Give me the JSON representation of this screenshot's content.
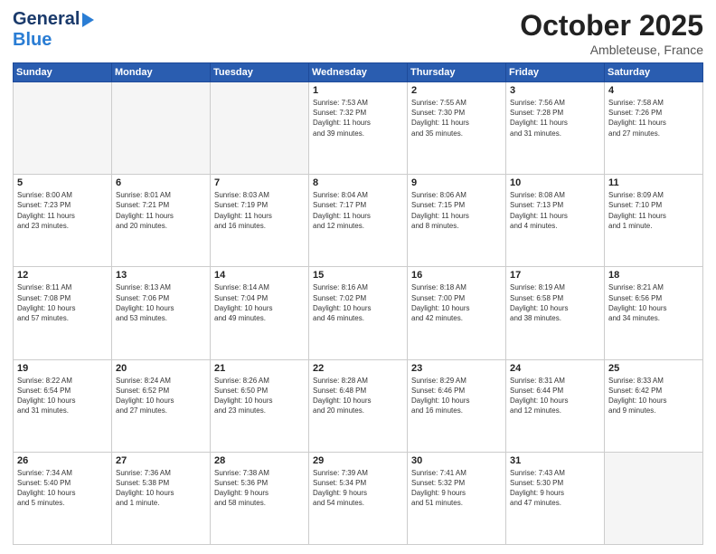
{
  "header": {
    "logo_line1": "General",
    "logo_line2": "Blue",
    "month": "October 2025",
    "location": "Ambleteuse, France"
  },
  "days_of_week": [
    "Sunday",
    "Monday",
    "Tuesday",
    "Wednesday",
    "Thursday",
    "Friday",
    "Saturday"
  ],
  "weeks": [
    [
      {
        "day": "",
        "empty": true,
        "lines": []
      },
      {
        "day": "",
        "empty": true,
        "lines": []
      },
      {
        "day": "",
        "empty": true,
        "lines": []
      },
      {
        "day": "1",
        "empty": false,
        "lines": [
          "Sunrise: 7:53 AM",
          "Sunset: 7:32 PM",
          "Daylight: 11 hours",
          "and 39 minutes."
        ]
      },
      {
        "day": "2",
        "empty": false,
        "lines": [
          "Sunrise: 7:55 AM",
          "Sunset: 7:30 PM",
          "Daylight: 11 hours",
          "and 35 minutes."
        ]
      },
      {
        "day": "3",
        "empty": false,
        "lines": [
          "Sunrise: 7:56 AM",
          "Sunset: 7:28 PM",
          "Daylight: 11 hours",
          "and 31 minutes."
        ]
      },
      {
        "day": "4",
        "empty": false,
        "lines": [
          "Sunrise: 7:58 AM",
          "Sunset: 7:26 PM",
          "Daylight: 11 hours",
          "and 27 minutes."
        ]
      }
    ],
    [
      {
        "day": "5",
        "empty": false,
        "lines": [
          "Sunrise: 8:00 AM",
          "Sunset: 7:23 PM",
          "Daylight: 11 hours",
          "and 23 minutes."
        ]
      },
      {
        "day": "6",
        "empty": false,
        "lines": [
          "Sunrise: 8:01 AM",
          "Sunset: 7:21 PM",
          "Daylight: 11 hours",
          "and 20 minutes."
        ]
      },
      {
        "day": "7",
        "empty": false,
        "lines": [
          "Sunrise: 8:03 AM",
          "Sunset: 7:19 PM",
          "Daylight: 11 hours",
          "and 16 minutes."
        ]
      },
      {
        "day": "8",
        "empty": false,
        "lines": [
          "Sunrise: 8:04 AM",
          "Sunset: 7:17 PM",
          "Daylight: 11 hours",
          "and 12 minutes."
        ]
      },
      {
        "day": "9",
        "empty": false,
        "lines": [
          "Sunrise: 8:06 AM",
          "Sunset: 7:15 PM",
          "Daylight: 11 hours",
          "and 8 minutes."
        ]
      },
      {
        "day": "10",
        "empty": false,
        "lines": [
          "Sunrise: 8:08 AM",
          "Sunset: 7:13 PM",
          "Daylight: 11 hours",
          "and 4 minutes."
        ]
      },
      {
        "day": "11",
        "empty": false,
        "lines": [
          "Sunrise: 8:09 AM",
          "Sunset: 7:10 PM",
          "Daylight: 11 hours",
          "and 1 minute."
        ]
      }
    ],
    [
      {
        "day": "12",
        "empty": false,
        "lines": [
          "Sunrise: 8:11 AM",
          "Sunset: 7:08 PM",
          "Daylight: 10 hours",
          "and 57 minutes."
        ]
      },
      {
        "day": "13",
        "empty": false,
        "lines": [
          "Sunrise: 8:13 AM",
          "Sunset: 7:06 PM",
          "Daylight: 10 hours",
          "and 53 minutes."
        ]
      },
      {
        "day": "14",
        "empty": false,
        "lines": [
          "Sunrise: 8:14 AM",
          "Sunset: 7:04 PM",
          "Daylight: 10 hours",
          "and 49 minutes."
        ]
      },
      {
        "day": "15",
        "empty": false,
        "lines": [
          "Sunrise: 8:16 AM",
          "Sunset: 7:02 PM",
          "Daylight: 10 hours",
          "and 46 minutes."
        ]
      },
      {
        "day": "16",
        "empty": false,
        "lines": [
          "Sunrise: 8:18 AM",
          "Sunset: 7:00 PM",
          "Daylight: 10 hours",
          "and 42 minutes."
        ]
      },
      {
        "day": "17",
        "empty": false,
        "lines": [
          "Sunrise: 8:19 AM",
          "Sunset: 6:58 PM",
          "Daylight: 10 hours",
          "and 38 minutes."
        ]
      },
      {
        "day": "18",
        "empty": false,
        "lines": [
          "Sunrise: 8:21 AM",
          "Sunset: 6:56 PM",
          "Daylight: 10 hours",
          "and 34 minutes."
        ]
      }
    ],
    [
      {
        "day": "19",
        "empty": false,
        "lines": [
          "Sunrise: 8:22 AM",
          "Sunset: 6:54 PM",
          "Daylight: 10 hours",
          "and 31 minutes."
        ]
      },
      {
        "day": "20",
        "empty": false,
        "lines": [
          "Sunrise: 8:24 AM",
          "Sunset: 6:52 PM",
          "Daylight: 10 hours",
          "and 27 minutes."
        ]
      },
      {
        "day": "21",
        "empty": false,
        "lines": [
          "Sunrise: 8:26 AM",
          "Sunset: 6:50 PM",
          "Daylight: 10 hours",
          "and 23 minutes."
        ]
      },
      {
        "day": "22",
        "empty": false,
        "lines": [
          "Sunrise: 8:28 AM",
          "Sunset: 6:48 PM",
          "Daylight: 10 hours",
          "and 20 minutes."
        ]
      },
      {
        "day": "23",
        "empty": false,
        "lines": [
          "Sunrise: 8:29 AM",
          "Sunset: 6:46 PM",
          "Daylight: 10 hours",
          "and 16 minutes."
        ]
      },
      {
        "day": "24",
        "empty": false,
        "lines": [
          "Sunrise: 8:31 AM",
          "Sunset: 6:44 PM",
          "Daylight: 10 hours",
          "and 12 minutes."
        ]
      },
      {
        "day": "25",
        "empty": false,
        "lines": [
          "Sunrise: 8:33 AM",
          "Sunset: 6:42 PM",
          "Daylight: 10 hours",
          "and 9 minutes."
        ]
      }
    ],
    [
      {
        "day": "26",
        "empty": false,
        "lines": [
          "Sunrise: 7:34 AM",
          "Sunset: 5:40 PM",
          "Daylight: 10 hours",
          "and 5 minutes."
        ]
      },
      {
        "day": "27",
        "empty": false,
        "lines": [
          "Sunrise: 7:36 AM",
          "Sunset: 5:38 PM",
          "Daylight: 10 hours",
          "and 1 minute."
        ]
      },
      {
        "day": "28",
        "empty": false,
        "lines": [
          "Sunrise: 7:38 AM",
          "Sunset: 5:36 PM",
          "Daylight: 9 hours",
          "and 58 minutes."
        ]
      },
      {
        "day": "29",
        "empty": false,
        "lines": [
          "Sunrise: 7:39 AM",
          "Sunset: 5:34 PM",
          "Daylight: 9 hours",
          "and 54 minutes."
        ]
      },
      {
        "day": "30",
        "empty": false,
        "lines": [
          "Sunrise: 7:41 AM",
          "Sunset: 5:32 PM",
          "Daylight: 9 hours",
          "and 51 minutes."
        ]
      },
      {
        "day": "31",
        "empty": false,
        "lines": [
          "Sunrise: 7:43 AM",
          "Sunset: 5:30 PM",
          "Daylight: 9 hours",
          "and 47 minutes."
        ]
      },
      {
        "day": "",
        "empty": true,
        "lines": []
      }
    ]
  ]
}
